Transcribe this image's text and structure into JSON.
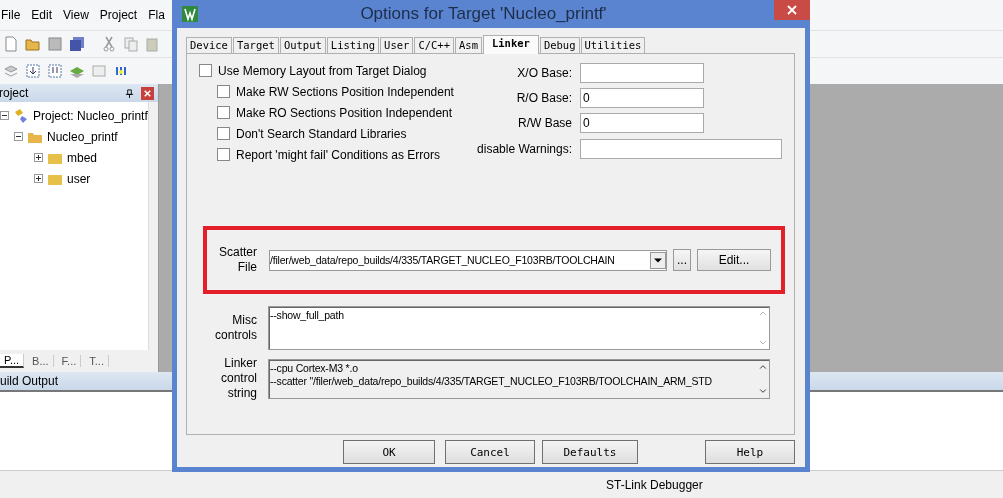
{
  "ide": {
    "menu": [
      "File",
      "Edit",
      "View",
      "Project",
      "Fla"
    ],
    "project_panel": {
      "title": "roject",
      "tree": [
        {
          "label": "Project: Nucleo_printf",
          "kind": "project",
          "expanded": true,
          "children": [
            {
              "label": "Nucleo_printf",
              "kind": "folder",
              "expanded": true,
              "children": [
                {
                  "label": "mbed",
                  "kind": "folder",
                  "expanded": false
                },
                {
                  "label": "user",
                  "kind": "folder",
                  "expanded": false
                }
              ]
            }
          ]
        }
      ],
      "tabs": [
        {
          "label": "P...",
          "selected": true
        },
        {
          "label": "B...",
          "selected": false
        },
        {
          "label": "F...",
          "selected": false
        },
        {
          "label": "T...",
          "selected": false
        }
      ]
    },
    "build_output": {
      "title": "uild Output"
    },
    "status_bar": {
      "debugger": "ST-Link Debugger"
    }
  },
  "dialog": {
    "title": "Options for Target 'Nucleo_printf'",
    "tabs": [
      {
        "label": "Device",
        "selected": false
      },
      {
        "label": "Target",
        "selected": false
      },
      {
        "label": "Output",
        "selected": false
      },
      {
        "label": "Listing",
        "selected": false
      },
      {
        "label": "User",
        "selected": false
      },
      {
        "label": "C/C++",
        "selected": false
      },
      {
        "label": "Asm",
        "selected": false
      },
      {
        "label": "Linker",
        "selected": true
      },
      {
        "label": "Debug",
        "selected": false
      },
      {
        "label": "Utilities",
        "selected": false
      }
    ],
    "options": [
      {
        "label": "Use Memory Layout from Target Dialog",
        "checked": false,
        "indented": false
      },
      {
        "label": "Make RW Sections Position Independent",
        "checked": false,
        "indented": true
      },
      {
        "label": "Make RO Sections Position Independent",
        "checked": false,
        "indented": true
      },
      {
        "label": "Don't Search Standard Libraries",
        "checked": false,
        "indented": true
      },
      {
        "label": "Report 'might fail' Conditions as Errors",
        "checked": false,
        "indented": true
      }
    ],
    "fields": [
      {
        "label": "X/O Base:",
        "wide": false
      },
      {
        "label": "R/O Base:",
        "value": "0",
        "wide": false
      },
      {
        "label": "R/W Base",
        "value": "0",
        "wide": false
      },
      {
        "label": "disable Warnings:",
        "wide": true
      }
    ],
    "scatter": {
      "label": "Scatter File",
      "value": "/filer/web_data/repo_builds/4/335/TARGET_NUCLEO_F103RB/TOOLCHAIN",
      "browse": "...",
      "edit": "Edit..."
    },
    "misc": {
      "label": "Misc controls",
      "value": "--show_full_path"
    },
    "linker_string": {
      "label": "Linker control string",
      "lines": [
        "--cpu Cortex-M3 *.o",
        "--scatter \"/filer/web_data/repo_builds/4/335/TARGET_NUCLEO_F103RB/TOOLCHAIN_ARM_STD"
      ]
    },
    "buttons": [
      "OK",
      "Cancel",
      "Defaults",
      "Help"
    ]
  }
}
